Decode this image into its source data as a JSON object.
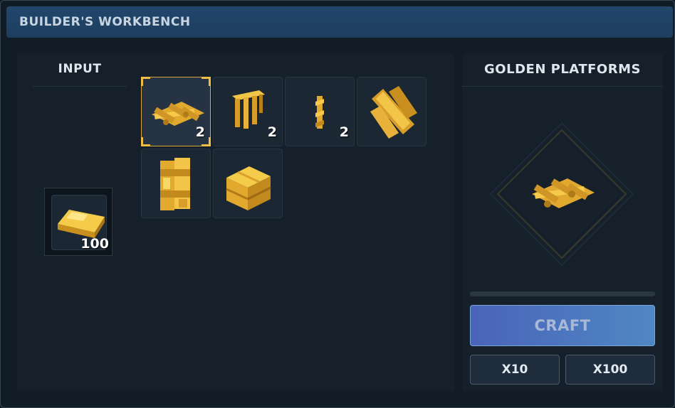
{
  "window": {
    "title": "BUILDER'S WORKBENCH"
  },
  "input": {
    "label": "INPUT",
    "item": {
      "icon": "gold-ingot-icon",
      "count": "100"
    }
  },
  "recipes": [
    {
      "icon": "golden-platform-icon",
      "count": "2",
      "selected": true
    },
    {
      "icon": "golden-fence-icon",
      "count": "2",
      "selected": false
    },
    {
      "icon": "golden-post-icon",
      "count": "2",
      "selected": false
    },
    {
      "icon": "golden-beam-stack-icon",
      "count": "",
      "selected": false
    },
    {
      "icon": "golden-pillar-icon",
      "count": "",
      "selected": false
    },
    {
      "icon": "golden-crate-icon",
      "count": "",
      "selected": false
    }
  ],
  "output": {
    "title": "GOLDEN PLATFORMS",
    "preview_icon": "golden-platform-icon",
    "progress": 0,
    "craft_label": "CRAFT",
    "x10_label": "X10",
    "x100_label": "X100"
  },
  "colors": {
    "gold": "#e8b23a",
    "accent": "#d9a83a",
    "craft_button": "#4f75c0"
  }
}
